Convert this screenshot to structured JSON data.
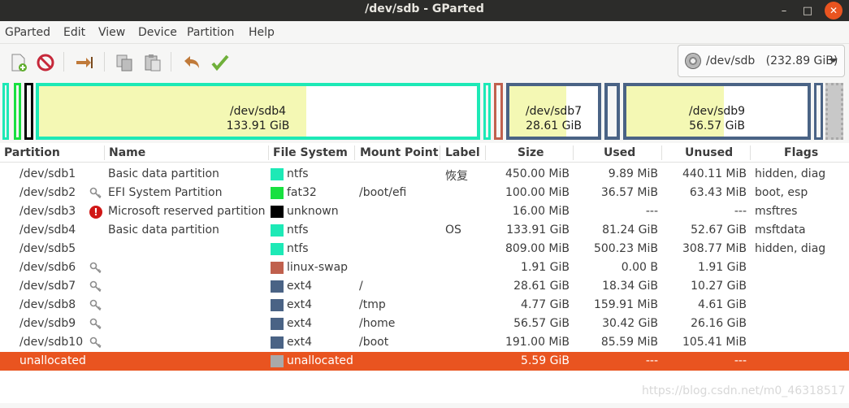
{
  "window": {
    "title": "/dev/sdb - GParted"
  },
  "menu": [
    "GParted",
    "Edit",
    "View",
    "Device",
    "Partition",
    "Help"
  ],
  "toolbar": {
    "icons": [
      "new-icon",
      "delete-icon",
      "resize-move-icon",
      "copy-icon",
      "paste-icon",
      "undo-icon",
      "apply-icon"
    ]
  },
  "device": {
    "label": "/dev/sdb",
    "size": "(232.89 GiB)"
  },
  "diskmap": {
    "sdb4": {
      "name": "/dev/sdb4",
      "size": "133.91 GiB",
      "used_fraction": 0.61,
      "color": "#1de9b6"
    },
    "sdb7": {
      "name": "/dev/sdb7",
      "size": "28.61 GiB",
      "used_fraction": 0.64,
      "color": "#4a6385"
    },
    "sdb9": {
      "name": "/dev/sdb9",
      "size": "56.57 GiB",
      "used_fraction": 0.54,
      "color": "#4a6385"
    }
  },
  "columns": [
    "Partition",
    "Name",
    "File System",
    "Mount Point",
    "Label",
    "Size",
    "Used",
    "Unused",
    "Flags"
  ],
  "rows": [
    {
      "partition": "/dev/sdb1",
      "name": "Basic data partition",
      "fs": "ntfs",
      "fs_color": "#1de9b6",
      "mount": "",
      "label": "恢复",
      "size": "450.00 MiB",
      "used": "9.89 MiB",
      "unused": "440.11 MiB",
      "flags": "hidden, diag",
      "icon": ""
    },
    {
      "partition": "/dev/sdb2",
      "name": "EFI System Partition",
      "fs": "fat32",
      "fs_color": "#18e040",
      "mount": "/boot/efi",
      "label": "",
      "size": "100.00 MiB",
      "used": "36.57 MiB",
      "unused": "63.43 MiB",
      "flags": "boot, esp",
      "icon": "key"
    },
    {
      "partition": "/dev/sdb3",
      "name": "Microsoft reserved partition",
      "fs": "unknown",
      "fs_color": "#000000",
      "mount": "",
      "label": "",
      "size": "16.00 MiB",
      "used": "---",
      "unused": "---",
      "flags": "msftres",
      "icon": "warn"
    },
    {
      "partition": "/dev/sdb4",
      "name": "Basic data partition",
      "fs": "ntfs",
      "fs_color": "#1de9b6",
      "mount": "",
      "label": "OS",
      "size": "133.91 GiB",
      "used": "81.24 GiB",
      "unused": "52.67 GiB",
      "flags": "msftdata",
      "icon": ""
    },
    {
      "partition": "/dev/sdb5",
      "name": "",
      "fs": "ntfs",
      "fs_color": "#1de9b6",
      "mount": "",
      "label": "",
      "size": "809.00 MiB",
      "used": "500.23 MiB",
      "unused": "308.77 MiB",
      "flags": "hidden, diag",
      "icon": ""
    },
    {
      "partition": "/dev/sdb6",
      "name": "",
      "fs": "linux-swap",
      "fs_color": "#c0604d",
      "mount": "",
      "label": "",
      "size": "1.91 GiB",
      "used": "0.00 B",
      "unused": "1.91 GiB",
      "flags": "",
      "icon": "key"
    },
    {
      "partition": "/dev/sdb7",
      "name": "",
      "fs": "ext4",
      "fs_color": "#4a6385",
      "mount": "/",
      "label": "",
      "size": "28.61 GiB",
      "used": "18.34 GiB",
      "unused": "10.27 GiB",
      "flags": "",
      "icon": "key"
    },
    {
      "partition": "/dev/sdb8",
      "name": "",
      "fs": "ext4",
      "fs_color": "#4a6385",
      "mount": "/tmp",
      "label": "",
      "size": "4.77 GiB",
      "used": "159.91 MiB",
      "unused": "4.61 GiB",
      "flags": "",
      "icon": "key"
    },
    {
      "partition": "/dev/sdb9",
      "name": "",
      "fs": "ext4",
      "fs_color": "#4a6385",
      "mount": "/home",
      "label": "",
      "size": "56.57 GiB",
      "used": "30.42 GiB",
      "unused": "26.16 GiB",
      "flags": "",
      "icon": "key"
    },
    {
      "partition": "/dev/sdb10",
      "name": "",
      "fs": "ext4",
      "fs_color": "#4a6385",
      "mount": "/boot",
      "label": "",
      "size": "191.00 MiB",
      "used": "85.59 MiB",
      "unused": "105.41 MiB",
      "flags": "",
      "icon": "key"
    },
    {
      "partition": "unallocated",
      "name": "",
      "fs": "unallocated",
      "fs_color": "#a9a9a9",
      "mount": "",
      "label": "",
      "size": "5.59 GiB",
      "used": "---",
      "unused": "---",
      "flags": "",
      "icon": "",
      "selected": true
    }
  ],
  "watermark": "https://blog.csdn.net/m0_46318517"
}
